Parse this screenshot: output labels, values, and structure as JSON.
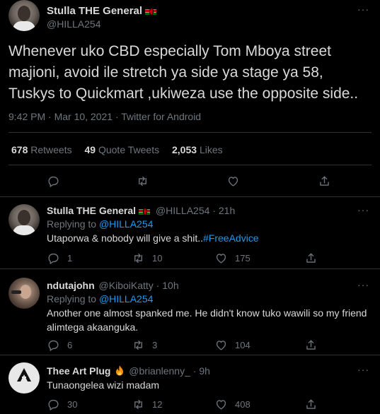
{
  "main": {
    "name": "Stulla THE General",
    "handle": "@HILLA254",
    "more": "···",
    "text": "Whenever uko CBD especially Tom Mboya street majioni, avoid ile stretch ya side ya stage ya 58, Tuskys to Quickmart ,ukiweza use the opposite side..",
    "meta": "9:42 PM · Mar 10, 2021 · Twitter for Android",
    "stats": {
      "retweets_num": "678",
      "retweets_label": "Retweets",
      "quotes_num": "49",
      "quotes_label": "Quote Tweets",
      "likes_num": "2,053",
      "likes_label": "Likes"
    },
    "actions": [
      "reply-icon",
      "retweet-icon",
      "like-icon",
      "share-icon"
    ]
  },
  "replies": [
    {
      "name": "Stulla THE General",
      "handle": "@HILLA254",
      "time": "21h",
      "replying_prefix": "Replying to ",
      "replying_to": "@HILLA254",
      "text": "Utaporwa & nobody will give a shit..",
      "hashtag": "#FreeAdvice",
      "replies": "1",
      "retweets": "10",
      "likes": "175"
    },
    {
      "name": "ndutajohn",
      "handle": "@KiboiKatty",
      "time": "10h",
      "replying_prefix": "Replying to ",
      "replying_to": "@HILLA254",
      "text": "Another one almost spanked me. He didn't know tuko wawili so my friend alimtega akaanguka.",
      "replies": "6",
      "retweets": "3",
      "likes": "104"
    },
    {
      "name": "Thee Art Plug",
      "handle": "@brianlenny_",
      "time": "9h",
      "text": "Tunaongelea wizi madam",
      "replies": "30",
      "retweets": "12",
      "likes": "408"
    }
  ],
  "colors": {
    "background": "#000000",
    "text": "#d9d9d9",
    "muted": "#6e767d",
    "link": "#1d9bf0",
    "border": "#2f3336"
  }
}
